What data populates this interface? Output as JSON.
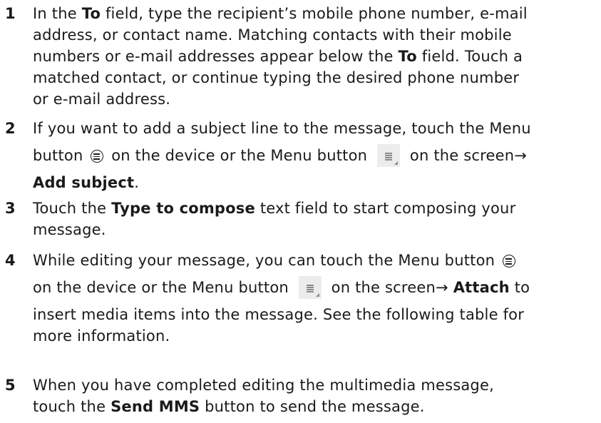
{
  "steps": [
    {
      "number": "1",
      "lines": [
        [
          "In the ",
          {
            "b": "To"
          },
          " field, type the recipient’s mobile phone number, e-mail"
        ],
        [
          "address, or contact name. Matching contacts with their mobile"
        ],
        [
          "numbers or e-mail addresses appear below the ",
          {
            "b": "To"
          },
          " field. Touch a"
        ],
        [
          "matched contact, or continue typing the desired phone number"
        ],
        [
          "or e-mail address."
        ]
      ]
    },
    {
      "number": "2",
      "lines": [
        [
          "If you want to add a subject line to the message, touch the Menu"
        ],
        [
          "button ",
          {
            "icon": "phone-menu-icon"
          },
          " on the device or the Menu button ",
          {
            "icon": "screen-menu-icon"
          },
          " on the screen→"
        ],
        [
          {
            "b": "Add subject"
          },
          "."
        ]
      ]
    },
    {
      "number": "3",
      "lines": [
        [
          "Touch the ",
          {
            "b": "Type to compose"
          },
          " text field to start composing your"
        ],
        [
          "message."
        ]
      ]
    },
    {
      "number": "4",
      "lines": [
        [
          "While editing your message, you can touch the Menu button ",
          {
            "icon": "phone-menu-icon"
          }
        ],
        [
          "on the device or the Menu button ",
          {
            "icon": "screen-menu-icon"
          },
          " on the screen→ ",
          {
            "b": "Attach"
          },
          " to"
        ],
        [
          "insert media items into the message. See the following table for"
        ],
        [
          "more information."
        ]
      ]
    },
    {
      "number": "5",
      "lines": [
        [
          "When you have completed editing the multimedia message,"
        ],
        [
          "touch the ",
          {
            "b": "Send MMS"
          },
          " button to send the message."
        ]
      ]
    }
  ]
}
